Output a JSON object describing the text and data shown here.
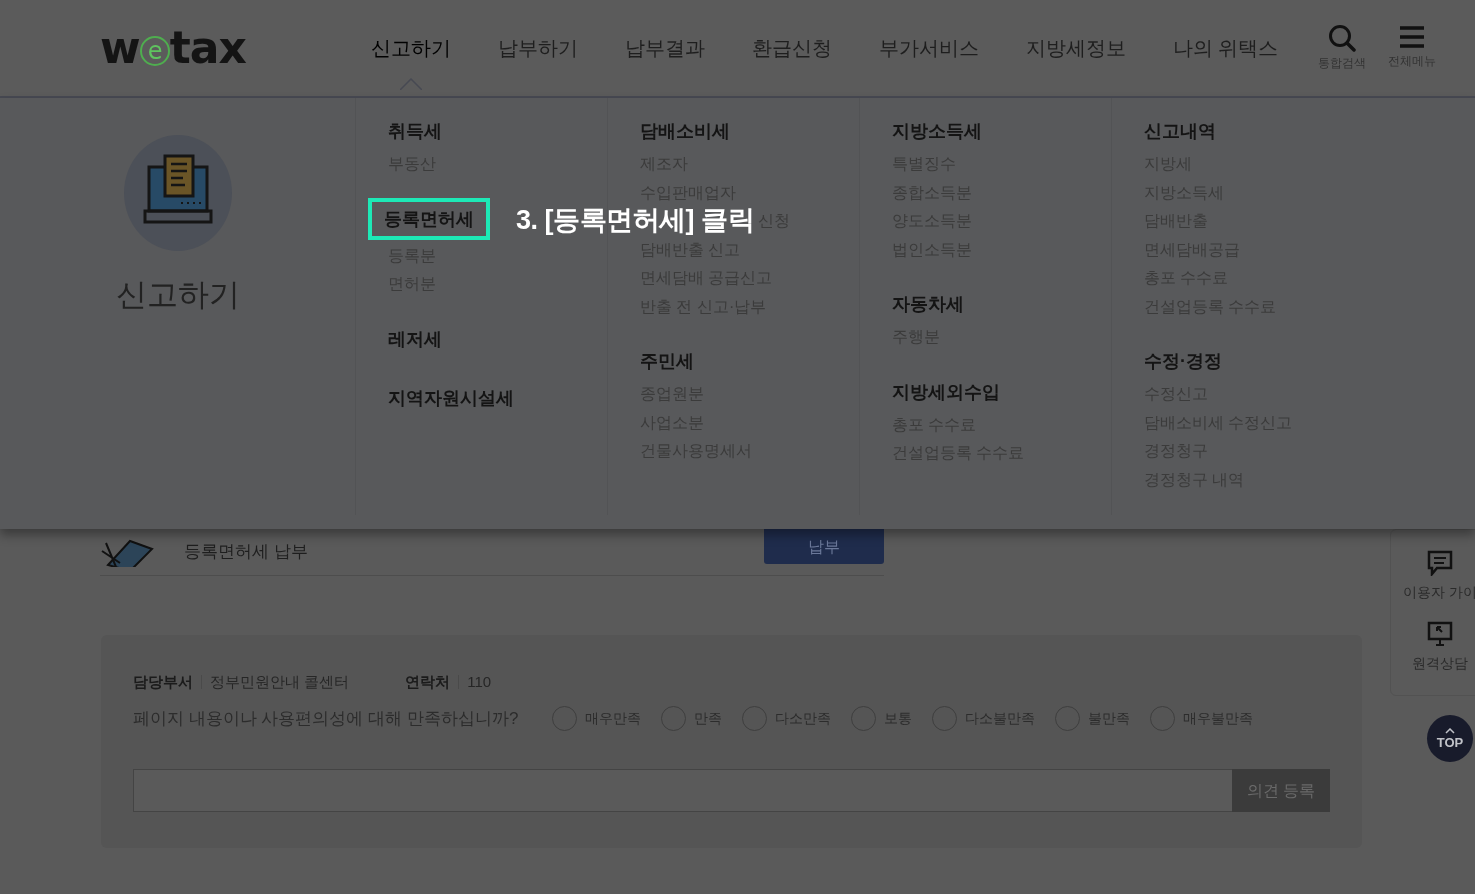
{
  "logo": {
    "prefix": "w",
    "circled": "e",
    "suffix": "tax"
  },
  "nav": [
    {
      "label": "신고하기",
      "selected": true
    },
    {
      "label": "납부하기",
      "selected": false
    },
    {
      "label": "납부결과",
      "selected": false
    },
    {
      "label": "환급신청",
      "selected": false
    },
    {
      "label": "부가서비스",
      "selected": false
    },
    {
      "label": "지방세정보",
      "selected": false
    },
    {
      "label": "나의 위택스",
      "selected": false
    }
  ],
  "tools": [
    {
      "kind": "search",
      "label": "통합검색"
    },
    {
      "kind": "menu",
      "label": "전체메뉴"
    }
  ],
  "mega_menu": {
    "title": "신고하기",
    "columns": [
      {
        "groups": [
          {
            "heading": "취득세",
            "highlighted": false,
            "items": [
              {
                "label": "부동산",
                "kind": "link"
              }
            ]
          },
          {
            "heading": "등록면허세",
            "highlighted": true,
            "items": [
              {
                "label": "등록분",
                "kind": "link"
              },
              {
                "label": "면허분",
                "kind": "link"
              }
            ]
          },
          {
            "heading": "레저세",
            "highlighted": false
          },
          {
            "heading": "지역자원시설세",
            "highlighted": false
          }
        ]
      },
      {
        "groups": [
          {
            "heading": "담배소비세",
            "highlighted": false,
            "items": [
              {
                "label": "제조자",
                "kind": "link"
              },
              {
                "label": "수입판매업자",
                "kind": "link"
              },
              {
                "label": "신청",
                "kind": "partial"
              },
              {
                "label": "담배반출 신고",
                "kind": "link"
              },
              {
                "label": "면세담배 공급신고",
                "kind": "link"
              },
              {
                "label": "반출 전 신고·납부",
                "kind": "link"
              }
            ]
          },
          {
            "heading": "주민세",
            "highlighted": false,
            "items": [
              {
                "label": "종업원분",
                "kind": "link"
              },
              {
                "label": "사업소분",
                "kind": "link"
              },
              {
                "label": "건물사용명세서",
                "kind": "link"
              }
            ]
          }
        ]
      },
      {
        "groups": [
          {
            "heading": "지방소득세",
            "highlighted": false,
            "items": [
              {
                "label": "특별징수",
                "kind": "link"
              },
              {
                "label": "종합소득분",
                "kind": "link"
              },
              {
                "label": "양도소득분",
                "kind": "link"
              },
              {
                "label": "법인소득분",
                "kind": "link"
              }
            ]
          },
          {
            "heading": "자동차세",
            "highlighted": false,
            "items": [
              {
                "label": "주행분",
                "kind": "link"
              }
            ]
          },
          {
            "heading": "지방세외수입",
            "highlighted": false,
            "items": [
              {
                "label": "총포 수수료",
                "kind": "link"
              },
              {
                "label": "건설업등록 수수료",
                "kind": "link"
              }
            ]
          }
        ]
      },
      {
        "groups": [
          {
            "heading": "신고내역",
            "highlighted": false,
            "items": [
              {
                "label": "지방세",
                "kind": "link"
              },
              {
                "label": "지방소득세",
                "kind": "link"
              },
              {
                "label": "담배반출",
                "kind": "link"
              },
              {
                "label": "면세담배공급",
                "kind": "link"
              },
              {
                "label": "총포 수수료",
                "kind": "link"
              },
              {
                "label": "건설업등록 수수료",
                "kind": "link"
              }
            ]
          },
          {
            "heading": "수정·경정",
            "highlighted": false,
            "items": [
              {
                "label": "수정신고",
                "kind": "link"
              },
              {
                "label": "담배소비세 수정신고",
                "kind": "link"
              },
              {
                "label": "경정청구",
                "kind": "link"
              },
              {
                "label": "경정청구 내역",
                "kind": "link"
              }
            ]
          }
        ]
      }
    ]
  },
  "annotation": {
    "text": "3. [등록면허세] 클릭"
  },
  "payment_row": {
    "label": "등록면허세 납부",
    "button": "납부"
  },
  "feedback": {
    "department_label": "담당부서",
    "department": "정부민원안내 콜센터",
    "contact_label": "연락처",
    "contact": "110",
    "question": "페이지 내용이나 사용편의성에 대해 만족하십니까?",
    "options": [
      {
        "label": "매우만족",
        "selected": false
      },
      {
        "label": "만족",
        "selected": false
      },
      {
        "label": "다소만족",
        "selected": false
      },
      {
        "label": "보통",
        "selected": false
      },
      {
        "label": "다소불만족",
        "selected": false
      },
      {
        "label": "불만족",
        "selected": false
      },
      {
        "label": "매우불만족",
        "selected": false
      }
    ],
    "submit": "의견 등록"
  },
  "quick_menu": [
    {
      "kind": "chat",
      "label": "이용자 가이"
    },
    {
      "kind": "monitor",
      "label": "원격상담"
    }
  ],
  "top_button": {
    "label": "TOP"
  }
}
